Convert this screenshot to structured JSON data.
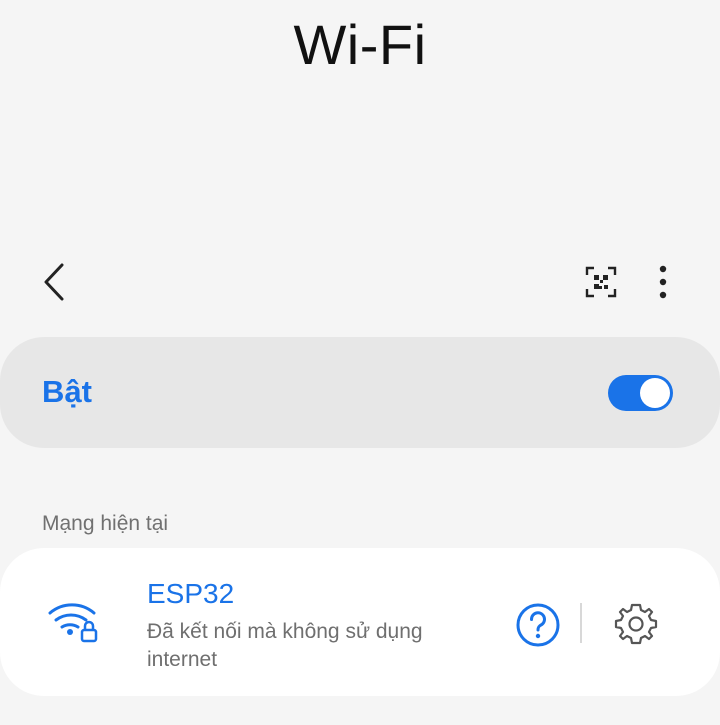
{
  "header": {
    "title": "Wi-Fi"
  },
  "toolbar": {
    "back_icon": "chevron-left-icon",
    "qr_icon": "qr-code-scan-icon",
    "more_icon": "more-vertical-icon"
  },
  "wifi_toggle": {
    "label": "Bật",
    "enabled": true
  },
  "current_network": {
    "section_label": "Mạng hiện tại",
    "name": "ESP32",
    "status": "Đã kết nối mà không sử dụng internet",
    "signal_icon": "wifi-lock-icon",
    "help_icon": "question-circle-icon",
    "settings_icon": "gear-icon"
  },
  "colors": {
    "accent": "#1a73e8",
    "background": "#f5f5f5"
  }
}
